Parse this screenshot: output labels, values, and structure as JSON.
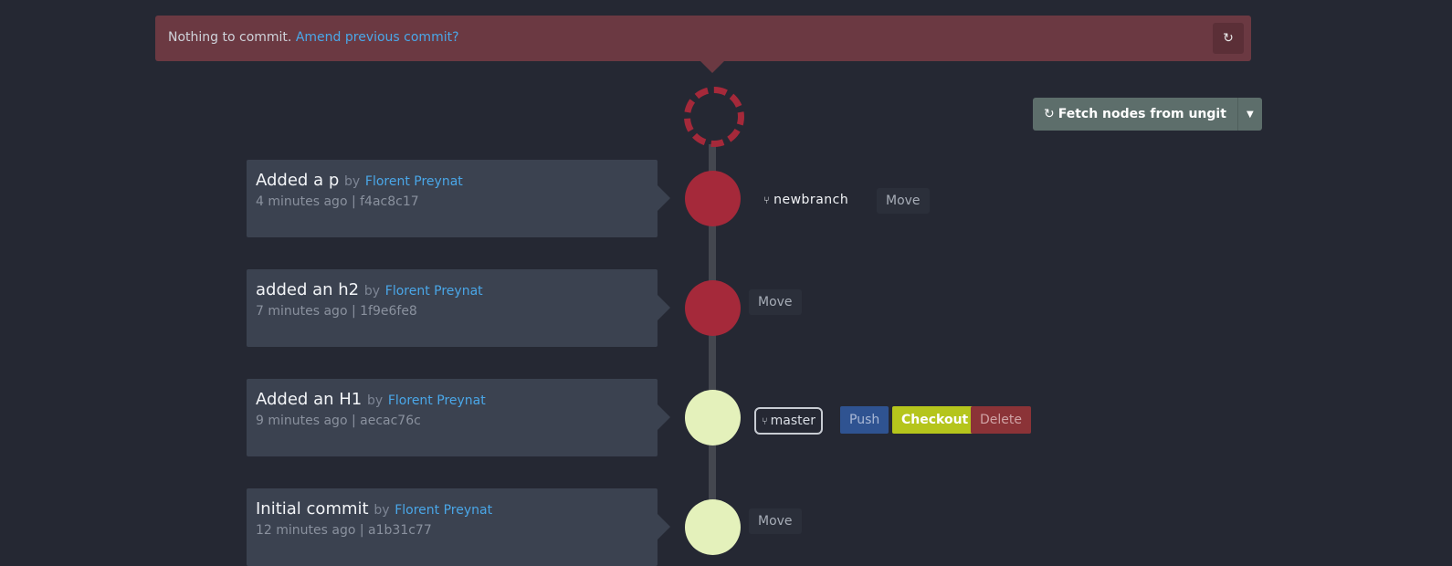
{
  "banner": {
    "message": "Nothing to commit.",
    "link": "Amend previous commit?",
    "refresh_icon": "refresh-icon"
  },
  "toolbar": {
    "fetch_label": "Fetch nodes from ungit",
    "fetch_icon": "refresh-icon",
    "dropdown_icon": "caret-down-icon"
  },
  "commits": [
    {
      "title": "Added a p",
      "by": "by",
      "author": "Florent Preynat",
      "meta": "4 minutes ago | f4ac8c17",
      "node_color": "#a5293a"
    },
    {
      "title": "added an h2",
      "by": "by",
      "author": "Florent Preynat",
      "meta": "7 minutes ago | 1f9e6fe8",
      "node_color": "#a5293a"
    },
    {
      "title": "Added an H1",
      "by": "by",
      "author": "Florent Preynat",
      "meta": "9 minutes ago | aecac76c",
      "node_color": "#e4f1bb"
    },
    {
      "title": "Initial commit",
      "by": "by",
      "author": "Florent Preynat",
      "meta": "12 minutes ago | a1b31c77",
      "node_color": "#e4f1bb"
    }
  ],
  "refs": {
    "newbranch": {
      "label": "newbranch",
      "icon": "branch-icon",
      "move": "Move"
    },
    "h2_move": "Move",
    "master": {
      "label": "master",
      "icon": "branch-icon",
      "push": "Push",
      "checkout": "Checkout",
      "delete": "Delete"
    },
    "initial_move": "Move"
  },
  "colors": {
    "background": "#252833",
    "card": "#3b4250",
    "node_red": "#a5293a",
    "node_pale": "#e4f1bb",
    "link": "#4aa7e8",
    "banner": "#6b3942",
    "push": "#2f5391",
    "checkout": "#b5c51c",
    "delete": "#8b3337"
  }
}
